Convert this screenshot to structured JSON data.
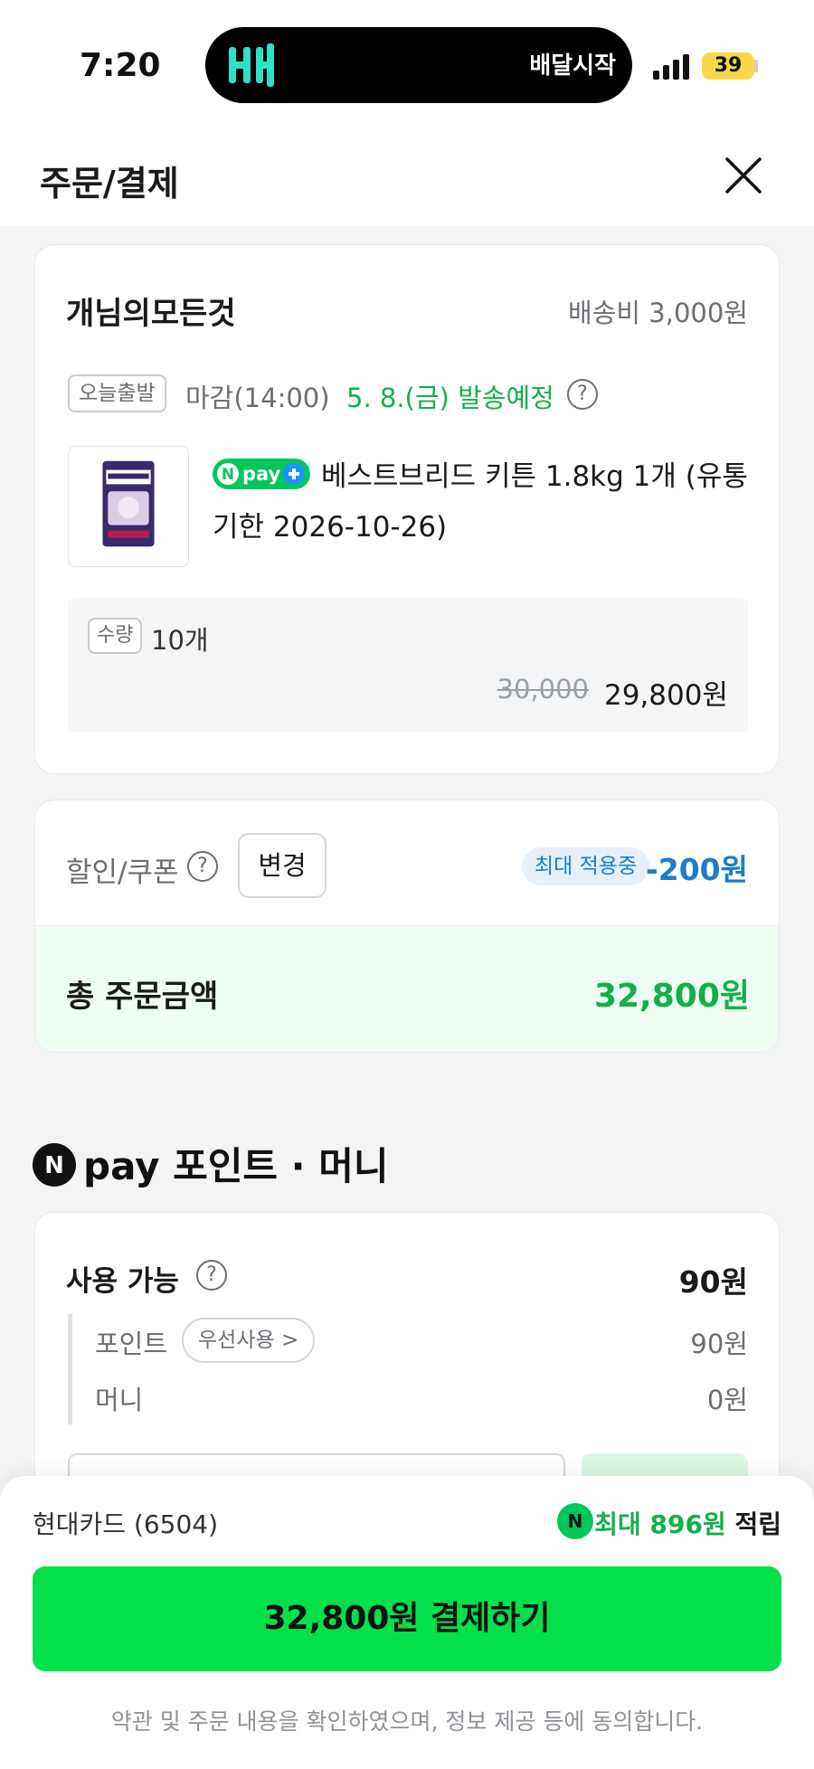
{
  "status_bar": {
    "time": "7:20",
    "island_text": "배달시작",
    "battery": "39"
  },
  "header": {
    "title": "주문/결제"
  },
  "order": {
    "seller": "개님의모든것",
    "shipping_fee": "배송비 3,000원",
    "today_badge": "오늘출발",
    "deadline": "마감(14:00)",
    "ship_date": "5. 8.(금) 발송예정",
    "npay_plus": "pay",
    "product_name": "베스트브리드 키튼 1.8kg 1개 (유통기한 2026-10-26)",
    "qty_badge": "수량",
    "qty_value": "10개",
    "original_price": "30,000",
    "sale_price": "29,800원"
  },
  "discount": {
    "label": "할인/쿠폰",
    "change_label": "변경",
    "max_badge": "최대 적용중",
    "value": "-200원"
  },
  "total": {
    "label": "총 주문금액",
    "value": "32,800원"
  },
  "npay": {
    "title": "pay 포인트 · 머니",
    "available_label": "사용 가능",
    "available_value": "90원",
    "point_label": "포인트",
    "priority_label": "우선사용 >",
    "point_value": "90원",
    "money_label": "머니",
    "money_value": "0원"
  },
  "bottom": {
    "card_name": "현대카드 (6504)",
    "reward_prefix": "최대 ",
    "reward_amount": "896원",
    "reward_suffix": " 적립",
    "pay_button": "32,800원 결제하기",
    "agreement": "약관 및 주문 내용을 확인하였으며, 정보 제공 등에 동의합니다."
  },
  "colors": {
    "brand_green": "#03e04b",
    "text_green": "#13b04a",
    "discount_blue": "#1a7ccc",
    "island_logo": "#2de0c8"
  }
}
